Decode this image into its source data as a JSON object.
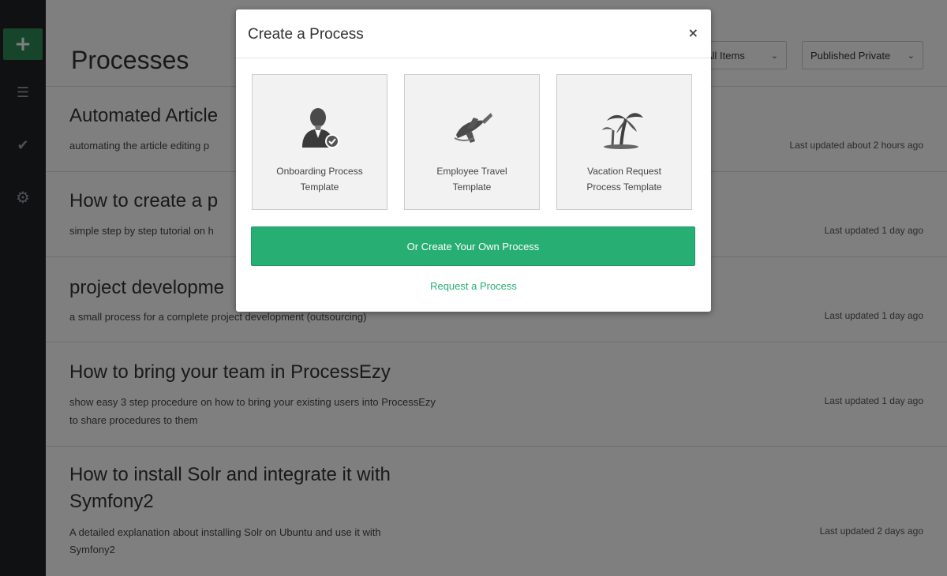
{
  "page": {
    "title": "Processes"
  },
  "sidebar": {
    "items": [
      {
        "icon": "plus-icon",
        "glyph": "+"
      },
      {
        "icon": "list-icon",
        "glyph": "☰"
      },
      {
        "icon": "check-icon",
        "glyph": "✔"
      },
      {
        "icon": "gear-icon",
        "glyph": "⚙"
      }
    ]
  },
  "filters": {
    "left": {
      "label": "All Items"
    },
    "right": {
      "label": "Published Private"
    }
  },
  "processes": [
    {
      "title": "Automated Article",
      "desc": [
        "automating the article editing p"
      ],
      "meta": "Last updated about 2 hours ago"
    },
    {
      "title": "How to create a p",
      "desc": [
        "simple step by step tutorial on h"
      ],
      "meta": "Last updated 1 day ago"
    },
    {
      "title": "project developme",
      "desc": [
        "a small process for a complete project development (outsourcing)"
      ],
      "meta": "Last updated 1 day ago"
    },
    {
      "title": "How to bring your team in ProcessEzy",
      "desc": [
        "show easy 3 step procedure on how to bring your existing users into ProcessEzy",
        "to share procedures to them"
      ],
      "meta": "Last updated 1 day ago"
    },
    {
      "title": "How to install Solr and integrate it with Symfony2",
      "desc": [
        "A detailed explanation about installing Solr on Ubuntu and use it with",
        "Symfony2"
      ],
      "meta": "Last updated 2 days ago"
    }
  ],
  "modal": {
    "title": "Create a Process",
    "close": "×",
    "templates": [
      {
        "label": "Onboarding Process Template",
        "icon": "person-icon"
      },
      {
        "label": "Employee Travel Template",
        "icon": "airplane-icon"
      },
      {
        "label": "Vacation Request Process Template",
        "icon": "palm-tree-icon"
      }
    ],
    "create_label": "Or Create Your Own Process",
    "request_label": "Request a Process"
  }
}
